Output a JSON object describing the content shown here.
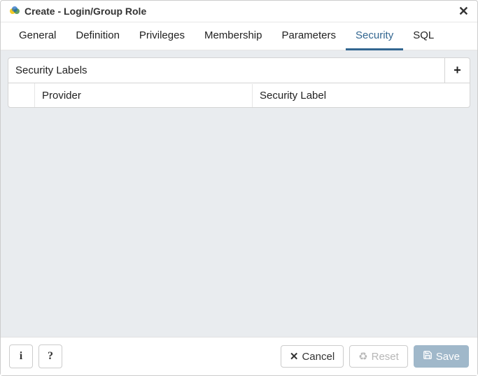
{
  "title": "Create - Login/Group Role",
  "tabs": [
    {
      "label": "General",
      "active": false
    },
    {
      "label": "Definition",
      "active": false
    },
    {
      "label": "Privileges",
      "active": false
    },
    {
      "label": "Membership",
      "active": false
    },
    {
      "label": "Parameters",
      "active": false
    },
    {
      "label": "Security",
      "active": true
    },
    {
      "label": "SQL",
      "active": false
    }
  ],
  "panel": {
    "title": "Security Labels",
    "columns": [
      "Provider",
      "Security Label"
    ]
  },
  "footer": {
    "cancel": "Cancel",
    "reset": "Reset",
    "save": "Save"
  }
}
